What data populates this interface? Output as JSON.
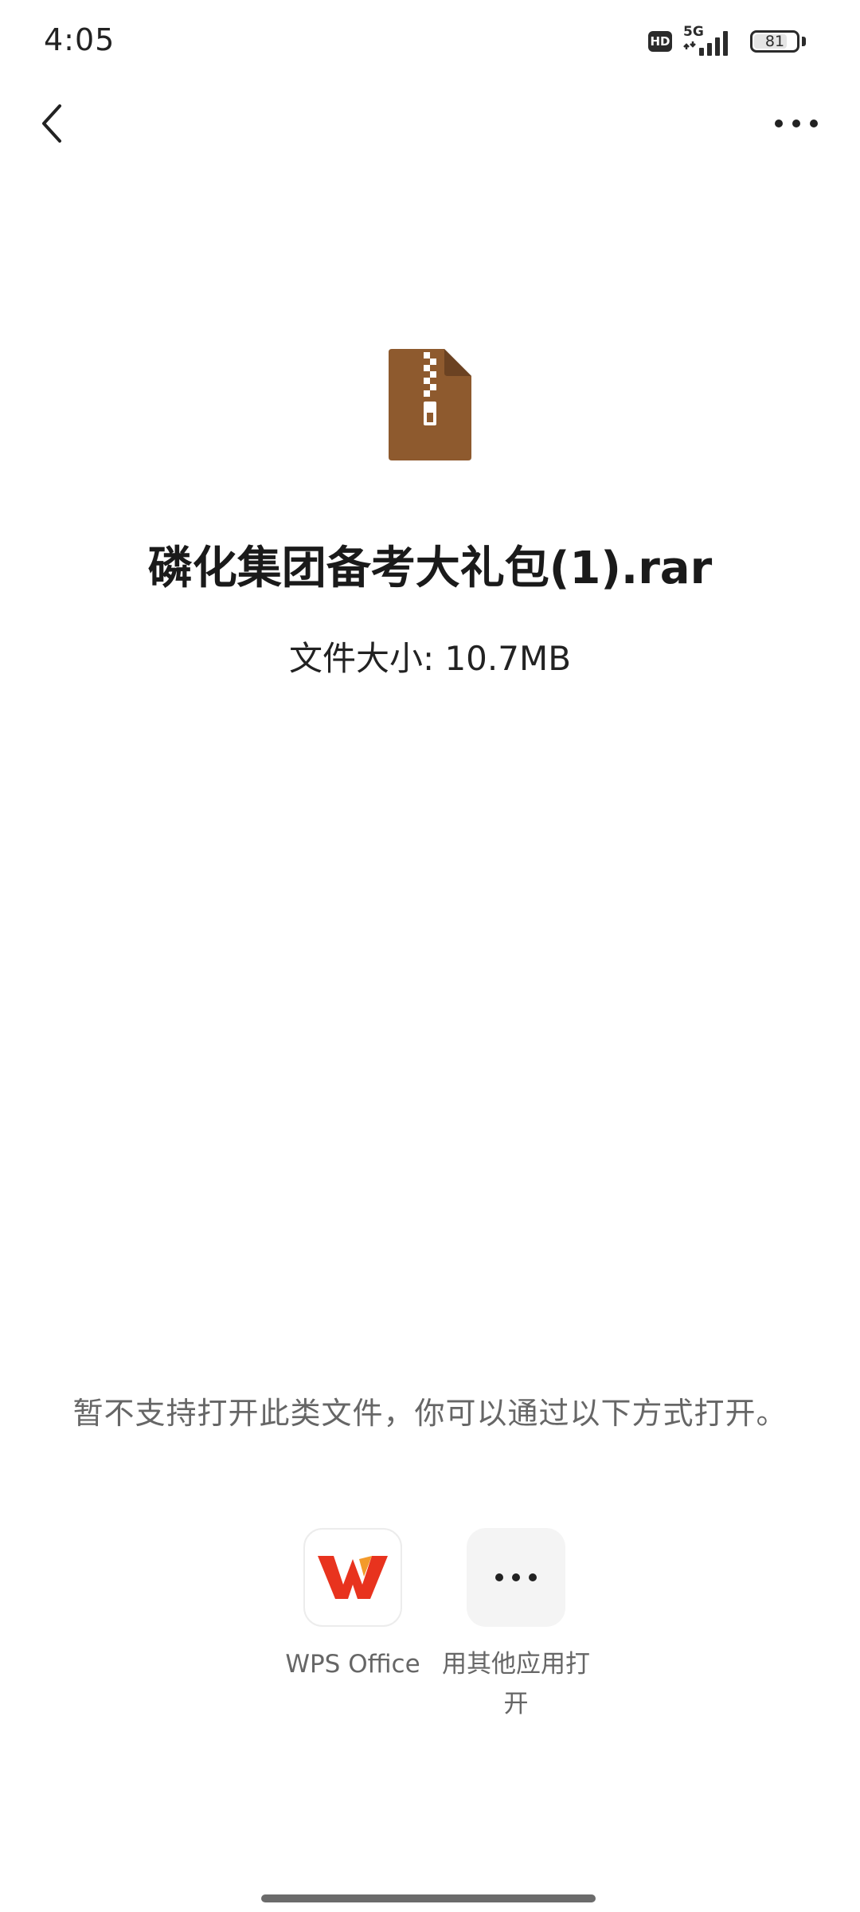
{
  "status_bar": {
    "time": "4:05",
    "hd_label": "HD",
    "network_label": "5G",
    "battery_level": "81"
  },
  "icons": {
    "back": "back-arrow-icon",
    "more": "more-icon",
    "file": "zip-archive-file-icon",
    "wps": "wps-office-icon",
    "other": "more-icon"
  },
  "file": {
    "name": "磷化集团备考大礼包(1).rar",
    "size": "文件大小: 10.7MB"
  },
  "message": "暂不支持打开此类文件，你可以通过以下方式打开。",
  "open_options": [
    {
      "label": "WPS Office"
    },
    {
      "label": "用其他应用打开"
    }
  ],
  "colors": {
    "file_icon": "#8e5a2e",
    "file_icon_fold": "#6b4222",
    "wps_red": "#e8331e"
  }
}
